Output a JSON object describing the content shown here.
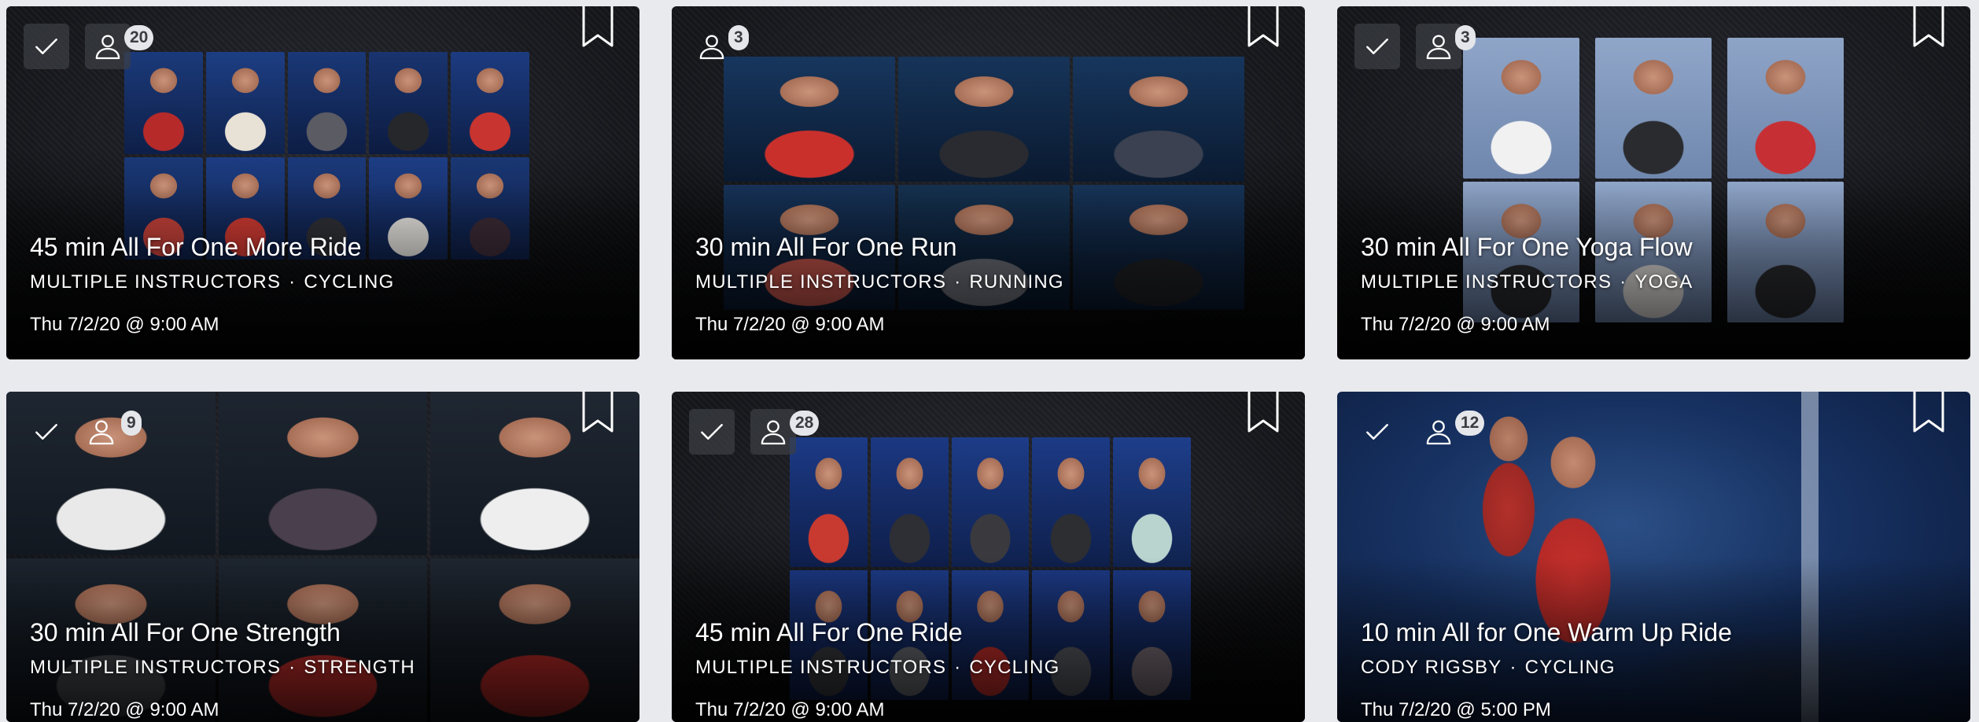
{
  "classes": [
    {
      "title": "45 min All For One More Ride",
      "instructor": "MULTIPLE INSTRUCTORS",
      "discipline": "CYCLING",
      "date": "Thu 7/2/20 @ 9:00 AM",
      "instructor_count": "20",
      "thumbnail": "instructor-collage-thumbnail"
    },
    {
      "title": "30 min All For One Run",
      "instructor": "MULTIPLE INSTRUCTORS",
      "discipline": "RUNNING",
      "date": "Thu 7/2/20 @ 9:00 AM",
      "instructor_count": "3",
      "thumbnail": "instructor-collage-thumbnail"
    },
    {
      "title": "30 min All For One Yoga Flow",
      "instructor": "MULTIPLE INSTRUCTORS",
      "discipline": "YOGA",
      "date": "Thu 7/2/20 @ 9:00 AM",
      "instructor_count": "3",
      "thumbnail": "instructor-collage-thumbnail"
    },
    {
      "title": "30 min All For One Strength",
      "instructor": "MULTIPLE INSTRUCTORS",
      "discipline": "STRENGTH",
      "date": "Thu 7/2/20 @ 9:00 AM",
      "instructor_count": "9",
      "thumbnail": "instructor-collage-thumbnail"
    },
    {
      "title": "45 min All For One Ride",
      "instructor": "MULTIPLE INSTRUCTORS",
      "discipline": "CYCLING",
      "date": "Thu 7/2/20 @ 9:00 AM",
      "instructor_count": "28",
      "thumbnail": "instructor-collage-thumbnail"
    },
    {
      "title": "10 min All for One Warm Up Ride",
      "instructor": "CODY RIGSBY",
      "discipline": "CYCLING",
      "date": "Thu 7/2/20 @ 5:00 PM",
      "instructor_count": "12",
      "thumbnail": "instructor-studio-thumbnail"
    }
  ],
  "separator": "·",
  "icons": {
    "check": "check-icon",
    "people": "person-icon",
    "bookmark": "bookmark-icon"
  },
  "colors": {
    "page_background": "#e9eaee",
    "card_background": "#17181c",
    "text": "#ffffff",
    "badge_background": "#e4e6ea",
    "badge_text": "#3a3c42"
  }
}
